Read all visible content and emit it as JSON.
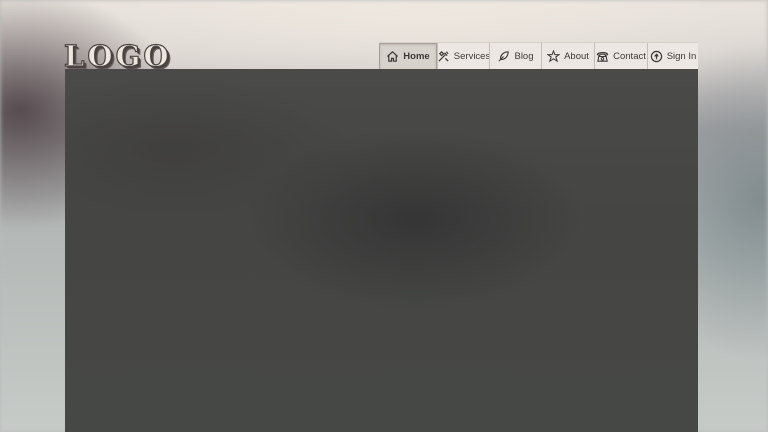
{
  "logo": {
    "text": "LOGO"
  },
  "nav": {
    "items": [
      {
        "label": "Home",
        "icon": "home-icon",
        "active": true
      },
      {
        "label": "Services",
        "icon": "tools-icon",
        "active": false
      },
      {
        "label": "Blog",
        "icon": "feather-icon",
        "active": false
      },
      {
        "label": "About",
        "icon": "info-icon",
        "active": false
      },
      {
        "label": "Contact",
        "icon": "phone-icon",
        "active": false
      },
      {
        "label": "Sign In",
        "icon": "sign-in-icon",
        "active": false
      }
    ]
  },
  "colors": {
    "nav_background": "#ece7e2",
    "nav_text": "#3e3938",
    "content_background": "#454644"
  }
}
